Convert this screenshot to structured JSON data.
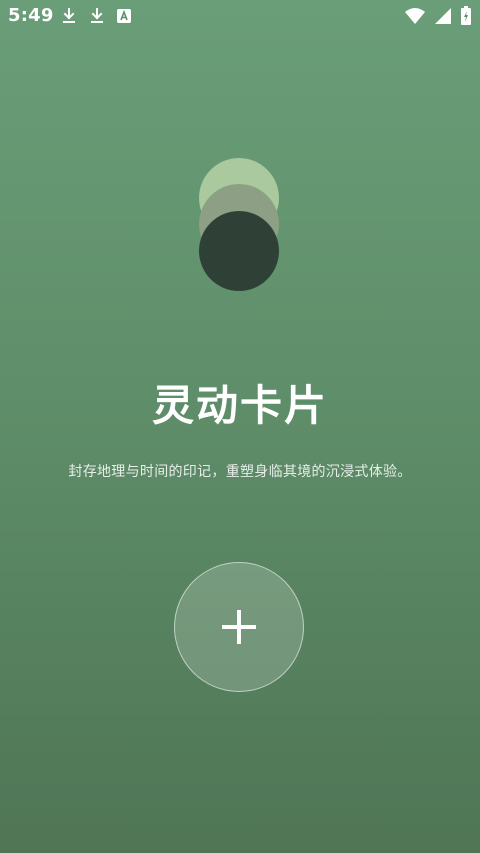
{
  "status_bar": {
    "time": "5:49",
    "left_icons": [
      "download-icon",
      "download-icon",
      "font-icon"
    ],
    "right_icons": [
      "wifi-icon",
      "signal-icon",
      "battery-charging-icon"
    ]
  },
  "hero": {
    "title": "灵动卡片",
    "subtitle": "封存地理与时间的印记，重塑身临其境的沉浸式体验。"
  },
  "add_button": {
    "icon": "plus-icon"
  },
  "colors": {
    "background_top": "#6a9e78",
    "background_bottom": "#4f7555",
    "logo_light": "#abc99f",
    "logo_mid": "#8d9f85",
    "logo_dark": "#2f4136"
  }
}
